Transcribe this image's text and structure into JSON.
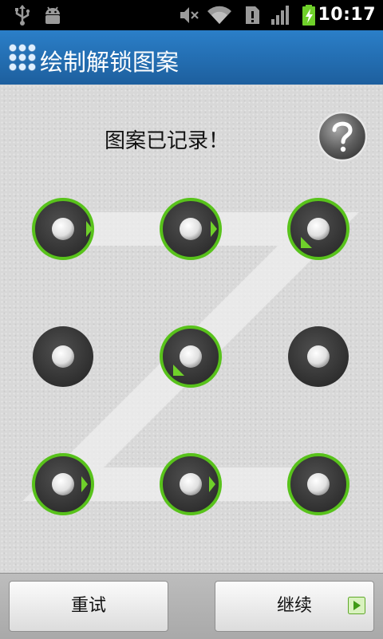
{
  "status_bar": {
    "time": "10:17",
    "icons": [
      "usb-icon",
      "android-debug-icon",
      "mute-icon",
      "wifi-icon",
      "sim-icon",
      "signal-icon",
      "battery-charging-icon"
    ]
  },
  "title_bar": {
    "title": "绘制解锁图案",
    "icon": "pattern-grid-icon"
  },
  "main": {
    "header": "图案已记录！",
    "help_icon": "help-icon"
  },
  "pattern": {
    "dots": [
      1,
      2,
      3,
      4,
      5,
      6,
      7,
      8,
      9
    ],
    "selected_sequence": [
      1,
      2,
      3,
      5,
      7,
      8,
      9
    ],
    "accent_color": "#6fd02a"
  },
  "buttons": {
    "retry_label": "重试",
    "continue_label": "继续"
  }
}
